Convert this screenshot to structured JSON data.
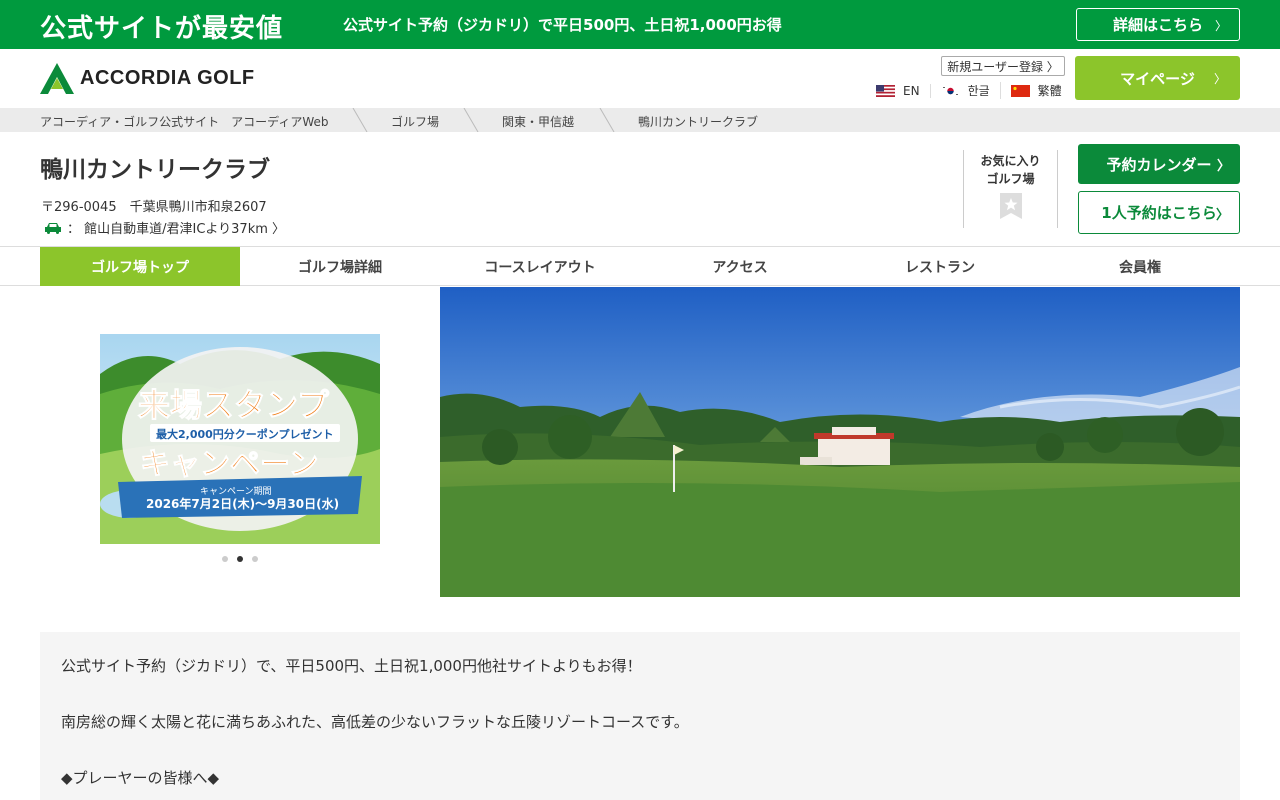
{
  "promo": {
    "title": "公式サイトが最安値",
    "text": "公式サイト予約（ジカドリ）で平日500円、土日祝1,000円お得",
    "button": "詳細はこちら"
  },
  "header": {
    "logo_text": "ACCORDIA GOLF",
    "signup": "新規ユーザー登録 〉",
    "languages": [
      "EN",
      "한글",
      "繁體"
    ],
    "mypage": "マイページ"
  },
  "breadcrumbs": [
    "アコーディア・ゴルフ公式サイト　アコーディアWeb",
    "ゴルフ場",
    "関東・甲信越",
    "鴨川カントリークラブ"
  ],
  "club": {
    "name": "鴨川カントリークラブ",
    "address": "〒296-0045　千葉県鴨川市和泉2607",
    "access": "：  館山自動車道/君津ICより37km 〉",
    "favorite_line1": "お気に入り",
    "favorite_line2": "ゴルフ場",
    "calendar_button": "予約カレンダー",
    "solo_button": "1人予約はこちら"
  },
  "nav": {
    "tabs": [
      "ゴルフ場トップ",
      "ゴルフ場詳細",
      "コースレイアウト",
      "アクセス",
      "レストラン",
      "会員権"
    ],
    "active_index": 0
  },
  "campaign": {
    "title1": "来場スタンプ",
    "subtitle": "最大2,000円分クーポンプレゼント",
    "title2": "キャンペーン",
    "period_label": "キャンペーン期間",
    "period": "2026年7月2日(木)～9月30日(水)",
    "slide_count": 3,
    "active_slide": 2
  },
  "description": {
    "lines": [
      "公式サイト予約（ジカドリ）で、平日500円、土日祝1,000円他社サイトよりもお得！",
      "南房総の輝く太陽と花に満ちあふれた、高低差の少ないフラットな丘陵リゾートコースです。",
      "◆プレーヤーの皆様へ◆"
    ]
  },
  "colors": {
    "promo_green": "#009a3e",
    "accent_lime": "#8cc52b",
    "button_green": "#0b8a3a"
  }
}
